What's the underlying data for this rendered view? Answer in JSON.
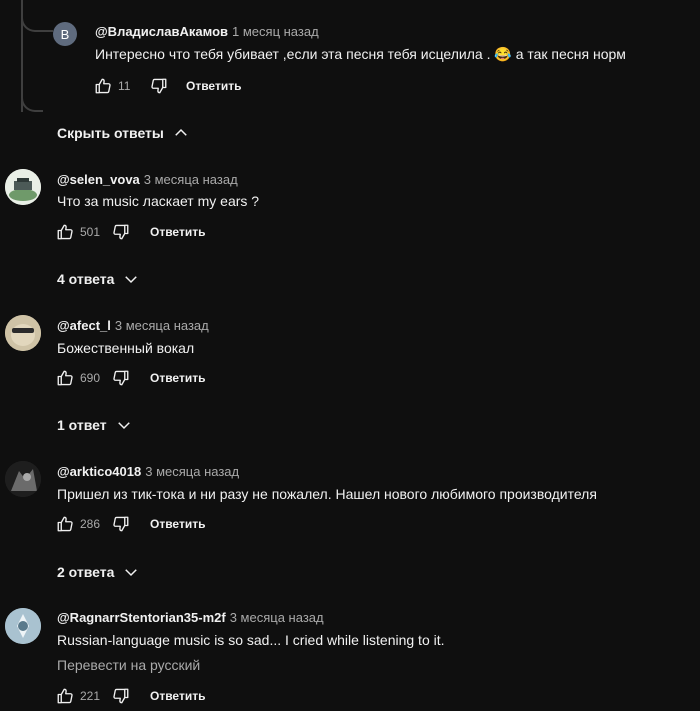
{
  "reply": {
    "avatar_letter": "В",
    "author": "@ВладиславАкамов",
    "time": "1 месяц назад",
    "text": "Интересно что тебя убивает ,если эта песня тебя исцелила .",
    "emoji": "😂",
    "text_after": "а так песня норм",
    "likes": "11",
    "reply_label": "Ответить"
  },
  "hide_replies_label": "Скрыть ответы",
  "comments": [
    {
      "author": "@selen_vova",
      "time": "3 месяца назад",
      "text": "Что за music ласкает my ears ?",
      "likes": "501",
      "reply_label": "Ответить",
      "replies_label": "4 ответа"
    },
    {
      "author": "@afect_l",
      "time": "3 месяца назад",
      "text": "Божественный вокал",
      "likes": "690",
      "reply_label": "Ответить",
      "replies_label": "1 ответ"
    },
    {
      "author": "@arktico4018",
      "time": "3 месяца назад",
      "text": "Пришел из тик-тока и ни разу не пожалел. Нашел нового любимого производителя",
      "likes": "286",
      "reply_label": "Ответить",
      "replies_label": "2 ответа"
    },
    {
      "author": "@RagnarrStentorian35-m2f",
      "time": "3 месяца назад",
      "text": "Russian-language music is so sad... I cried while listening to it.",
      "translate_label": "Перевести на русский",
      "likes": "221",
      "reply_label": "Ответить"
    }
  ],
  "colors": {
    "background": "#0f0f0f",
    "primary_text": "#f1f1f1",
    "secondary_text": "#aaaaaa",
    "reply_avatar": "#5f6b7e"
  }
}
